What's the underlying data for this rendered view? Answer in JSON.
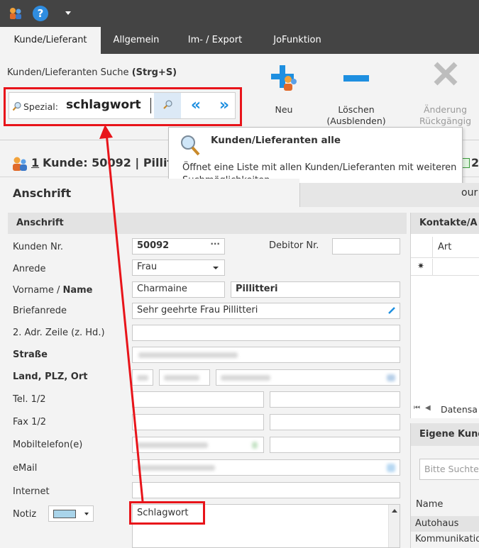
{
  "tabs": [
    {
      "label": "Kunde/Lieferant",
      "active": true
    },
    {
      "label": "Allgemein",
      "active": false
    },
    {
      "label": "Im- / Export",
      "active": false
    },
    {
      "label": "JoFunktion",
      "active": false
    }
  ],
  "ribbon": {
    "search_title": "Kunden/Lieferanten Suche",
    "search_shortcut": "(Strg+S)",
    "search_label": "Spezial:",
    "search_value": "schlagwort",
    "new_label": "Neu",
    "delete_label_1": "Löschen",
    "delete_label_2": "(Ausblenden)",
    "undo_label_1": "Änderung",
    "undo_label_2": "Rückgängig"
  },
  "tooltip": {
    "title": "Kunden/Lieferanten alle",
    "body": "Öffnet eine Liste mit allen Kunden/Lieferanten mit weiteren Suchmöglichkeiten"
  },
  "record": {
    "header_index": "1",
    "header_text": "Kunde: 50092 | Pillitt",
    "right_tab_num": "2",
    "section_title": "Anschrift",
    "right_tab_partial": "our"
  },
  "form": {
    "group_title": "Anschrift",
    "customer_no_label": "Kunden Nr.",
    "customer_no": "50092",
    "debitor_label": "Debitor Nr.",
    "debitor_value": "",
    "salutation_label": "Anrede",
    "salutation": "Frau",
    "name_label_first": "Vorname / ",
    "name_label_last": "Name",
    "first_name": "Charmaine",
    "last_name": "Pillitteri",
    "letter_label": "Briefanrede",
    "letter_value": "Sehr geehrte Frau Pillitteri",
    "addr2_label": "2. Adr. Zeile (z. Hd.)",
    "street_label": "Straße",
    "country_label": "Land, PLZ, Ort",
    "tel_label": "Tel. 1/2",
    "fax_label": "Fax 1/2",
    "mobile_label": "Mobiltelefon(e)",
    "email_label": "eMail",
    "internet_label": "Internet",
    "note_label": "Notiz",
    "note_value": "Schlagwort"
  },
  "contacts": {
    "title": "Kontakte/A",
    "col_art": "Art",
    "new_row_marker": "✷",
    "nav_text": "Datensa"
  },
  "own": {
    "title": "Eigene Kund",
    "search_placeholder": "Bitte Suchte",
    "col_name": "Name",
    "row1": "Autohaus",
    "row2": "Kommunikatio"
  },
  "colors": {
    "accent": "#1e8fe0",
    "highlight": "#e8141a",
    "dark": "#444444"
  }
}
